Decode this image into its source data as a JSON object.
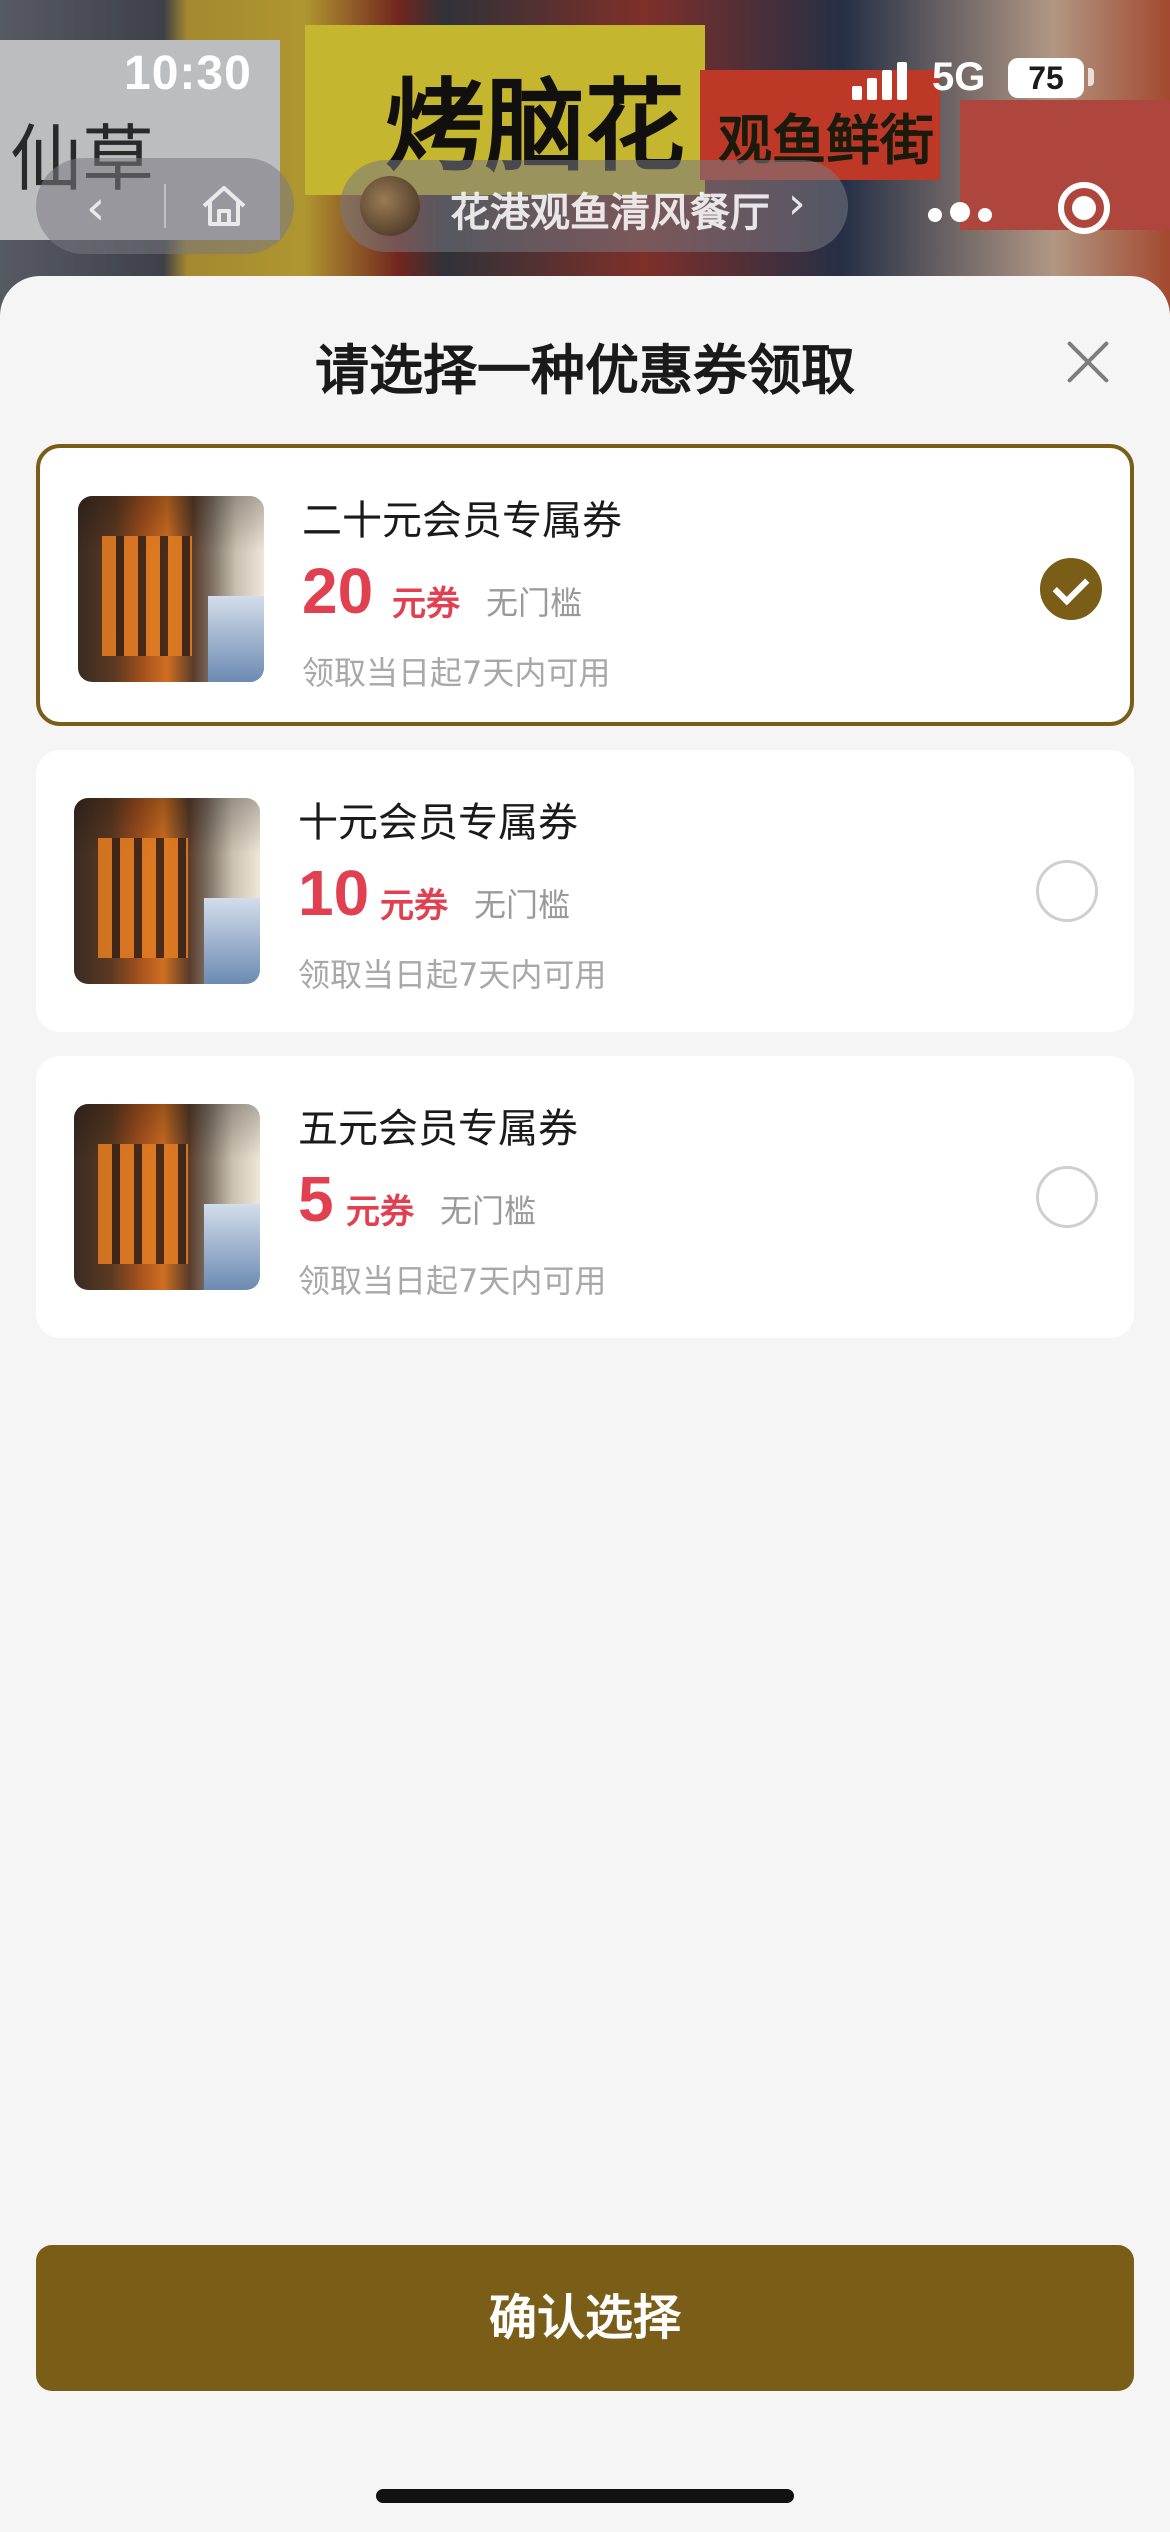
{
  "status_bar": {
    "time": "10:30",
    "network": "5G",
    "battery": "75"
  },
  "background": {
    "sign_a": "仙草",
    "sign_b": "烤脑花",
    "sign_c": "观鱼鲜街"
  },
  "header": {
    "store_name": "花港观鱼清风餐厅"
  },
  "sheet": {
    "title": "请选择一种优惠券领取",
    "coupons": [
      {
        "name": "二十元会员专属券",
        "amount": "20",
        "unit": "元券",
        "threshold": "无门槛",
        "validity": "领取当日起7天内可用",
        "selected": true
      },
      {
        "name": "十元会员专属券",
        "amount": "10",
        "unit": "元券",
        "threshold": "无门槛",
        "validity": "领取当日起7天内可用",
        "selected": false
      },
      {
        "name": "五元会员专属券",
        "amount": "5",
        "unit": "元券",
        "threshold": "无门槛",
        "validity": "领取当日起7天内可用",
        "selected": false
      }
    ],
    "confirm_label": "确认选择"
  },
  "colors": {
    "accent": "#7a5e18",
    "price": "#e04050"
  }
}
